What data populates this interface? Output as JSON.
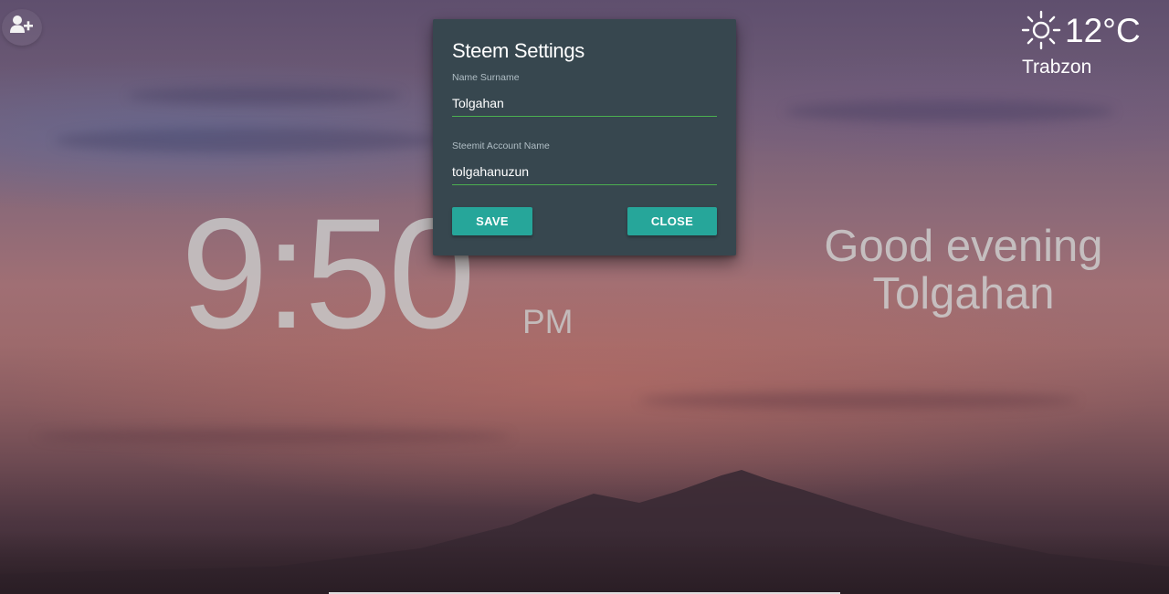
{
  "topbar": {
    "add_user_icon": "add-user-icon"
  },
  "weather": {
    "icon": "sun-icon",
    "temperature": "12°C",
    "city": "Trabzon"
  },
  "clock": {
    "time": "9:50",
    "period": "PM"
  },
  "greeting": {
    "line1": "Good evening",
    "line2": "Tolgahan"
  },
  "settings_modal": {
    "title": "Steem Settings",
    "name_label": "Name Surname",
    "name_value": "Tolgahan",
    "account_label": "Steemit Account Name",
    "account_value": "tolgahanuzun",
    "save_label": "SAVE",
    "close_label": "CLOSE"
  },
  "colors": {
    "modal_bg": "#37474f",
    "button": "#26a69a",
    "input_underline": "#4caf50"
  }
}
